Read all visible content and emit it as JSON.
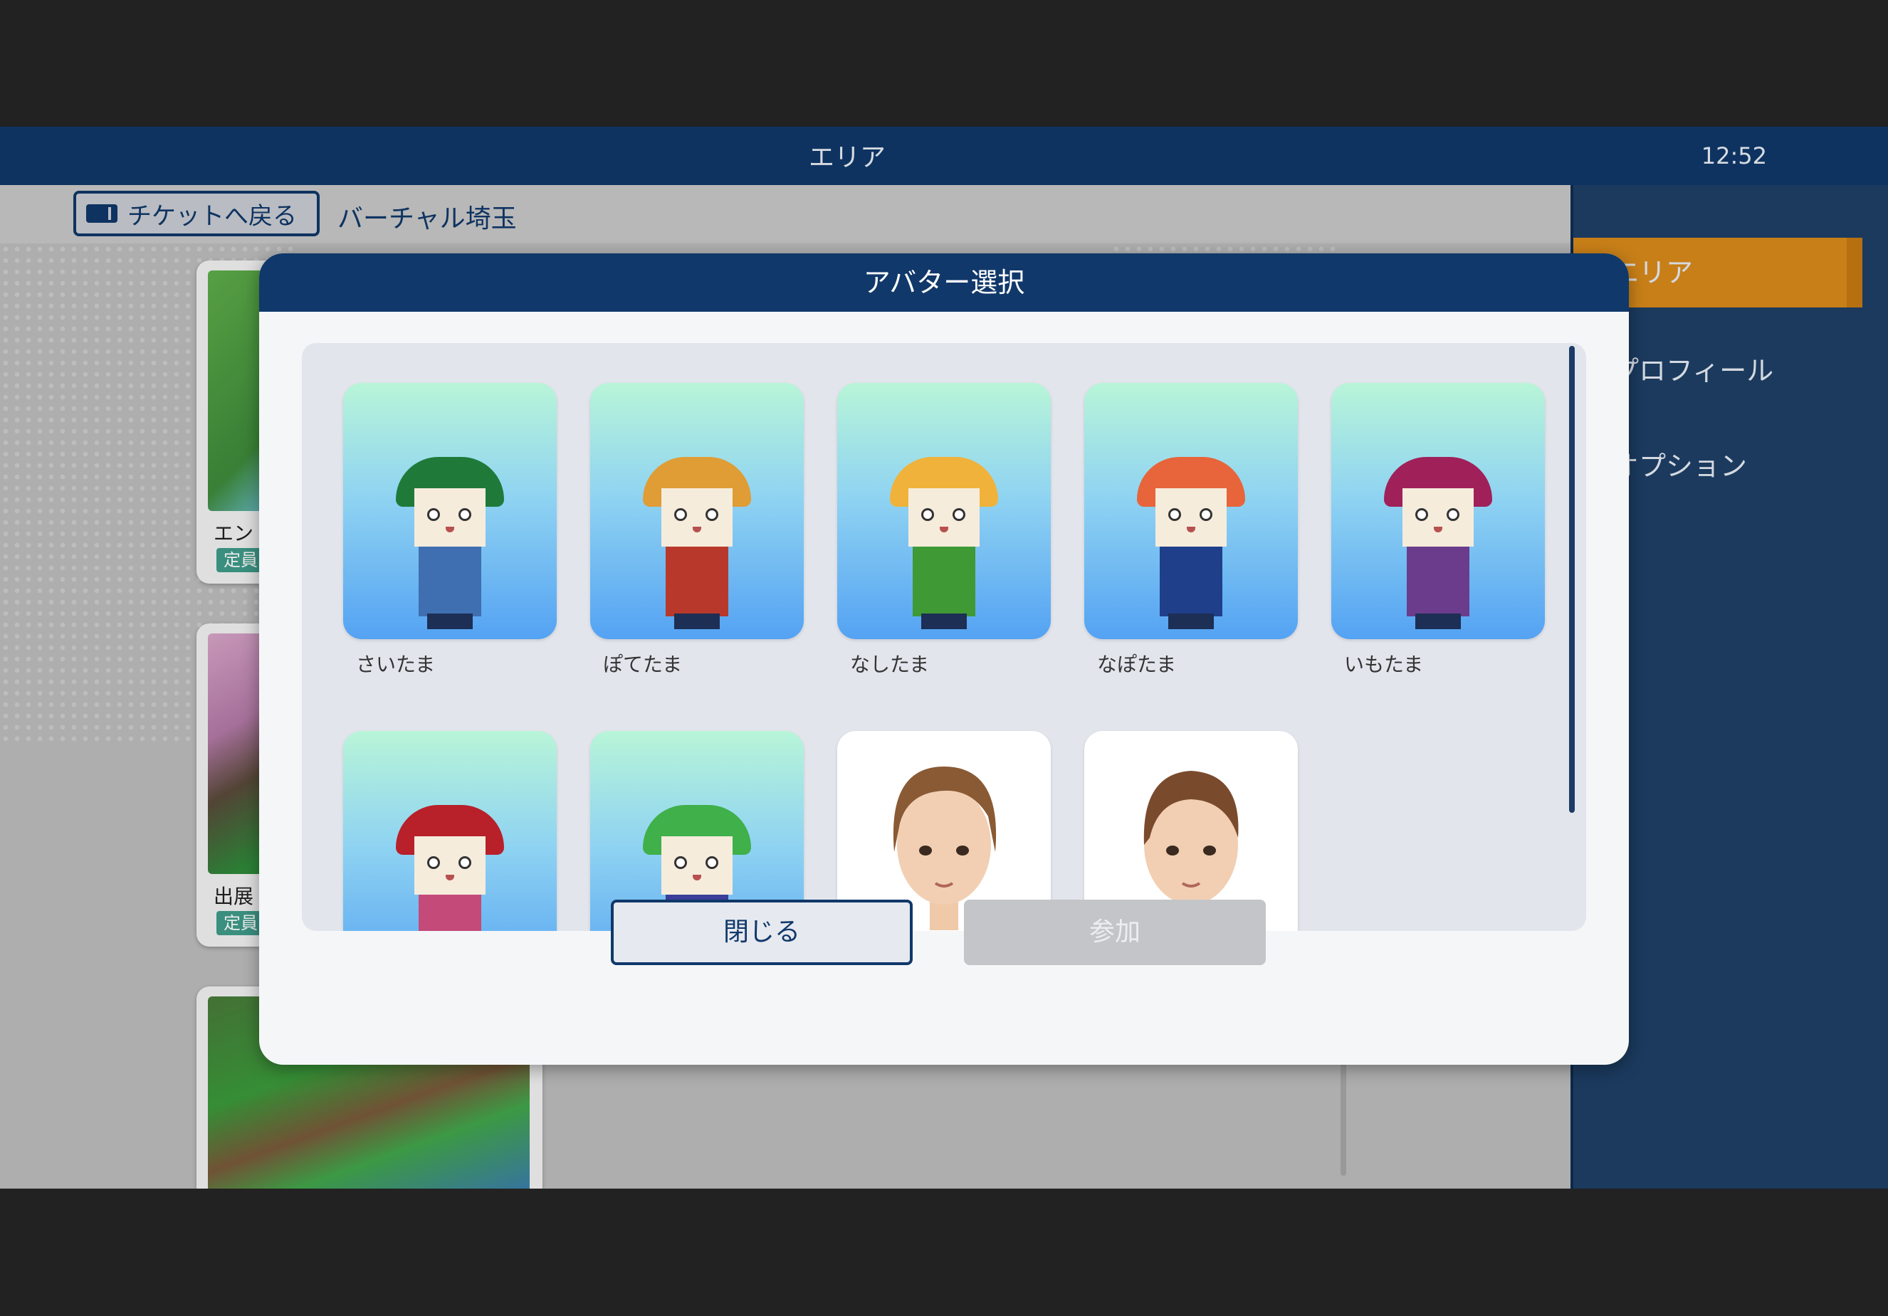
{
  "topbar": {
    "title": "エリア",
    "clock": "12:52"
  },
  "subbar": {
    "back_label": "チケットへ戻る",
    "world_name": "バーチャル埼玉"
  },
  "area_list": {
    "cards": [
      {
        "name": "エン",
        "badge": "定員"
      },
      {
        "name": "出展",
        "badge": "定員"
      },
      {
        "name": "",
        "badge": ""
      }
    ]
  },
  "side_menu": {
    "items": [
      {
        "label": "エリア",
        "active": true
      },
      {
        "label": "プロフィール",
        "active": false
      },
      {
        "label": "オプション",
        "active": false
      }
    ]
  },
  "modal": {
    "title": "アバター選択",
    "avatars": [
      {
        "label": "さいたま",
        "color": "#3f6fb0",
        "hair": "#1f7a3a"
      },
      {
        "label": "ぽてたま",
        "color": "#b8392b",
        "hair": "#e09c35"
      },
      {
        "label": "なしたま",
        "color": "#3f9a35",
        "hair": "#f0b23a"
      },
      {
        "label": "なぽたま",
        "color": "#1f3f8a",
        "hair": "#e8643a"
      },
      {
        "label": "いもたま",
        "color": "#6b3c8c",
        "hair": "#a0205a"
      },
      {
        "label": "",
        "color": "#c44a7a",
        "hair": "#b8202a"
      },
      {
        "label": "",
        "color": "#3b3f9a",
        "hair": "#3fb04a"
      },
      {
        "label": "",
        "type": "human-male"
      },
      {
        "label": "",
        "type": "human-female"
      }
    ],
    "close_label": "閉じる",
    "join_label": "参加"
  }
}
